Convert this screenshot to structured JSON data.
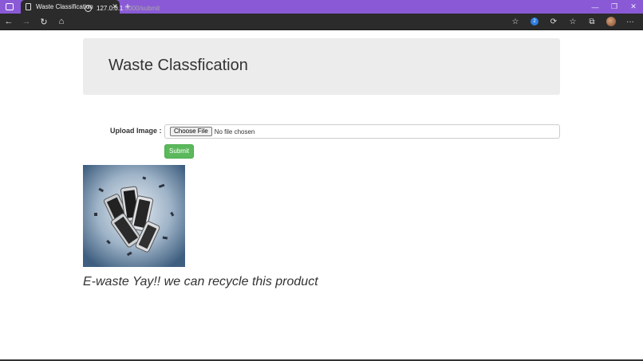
{
  "browser": {
    "tab_title": "Waste Classification",
    "url_host": "127.0.0.1",
    "url_path": ":5000/submit",
    "extension_badge": "2"
  },
  "page": {
    "heading": "Waste Classfication",
    "upload_label": "Upload Image :",
    "choose_file_label": "Choose File",
    "no_file_text": "No file chosen",
    "submit_label": "Submit",
    "result_text": "E-waste Yay!! we can recycle this product"
  },
  "icons": {
    "back": "back-arrow-icon",
    "forward": "forward-arrow-icon",
    "refresh": "refresh-icon",
    "home": "home-icon",
    "info": "info-icon"
  },
  "colors": {
    "tabstrip": "#8a5ad6",
    "toolbar": "#2b2b2b",
    "jumbotron": "#ececec",
    "submit": "#5cb85c"
  }
}
